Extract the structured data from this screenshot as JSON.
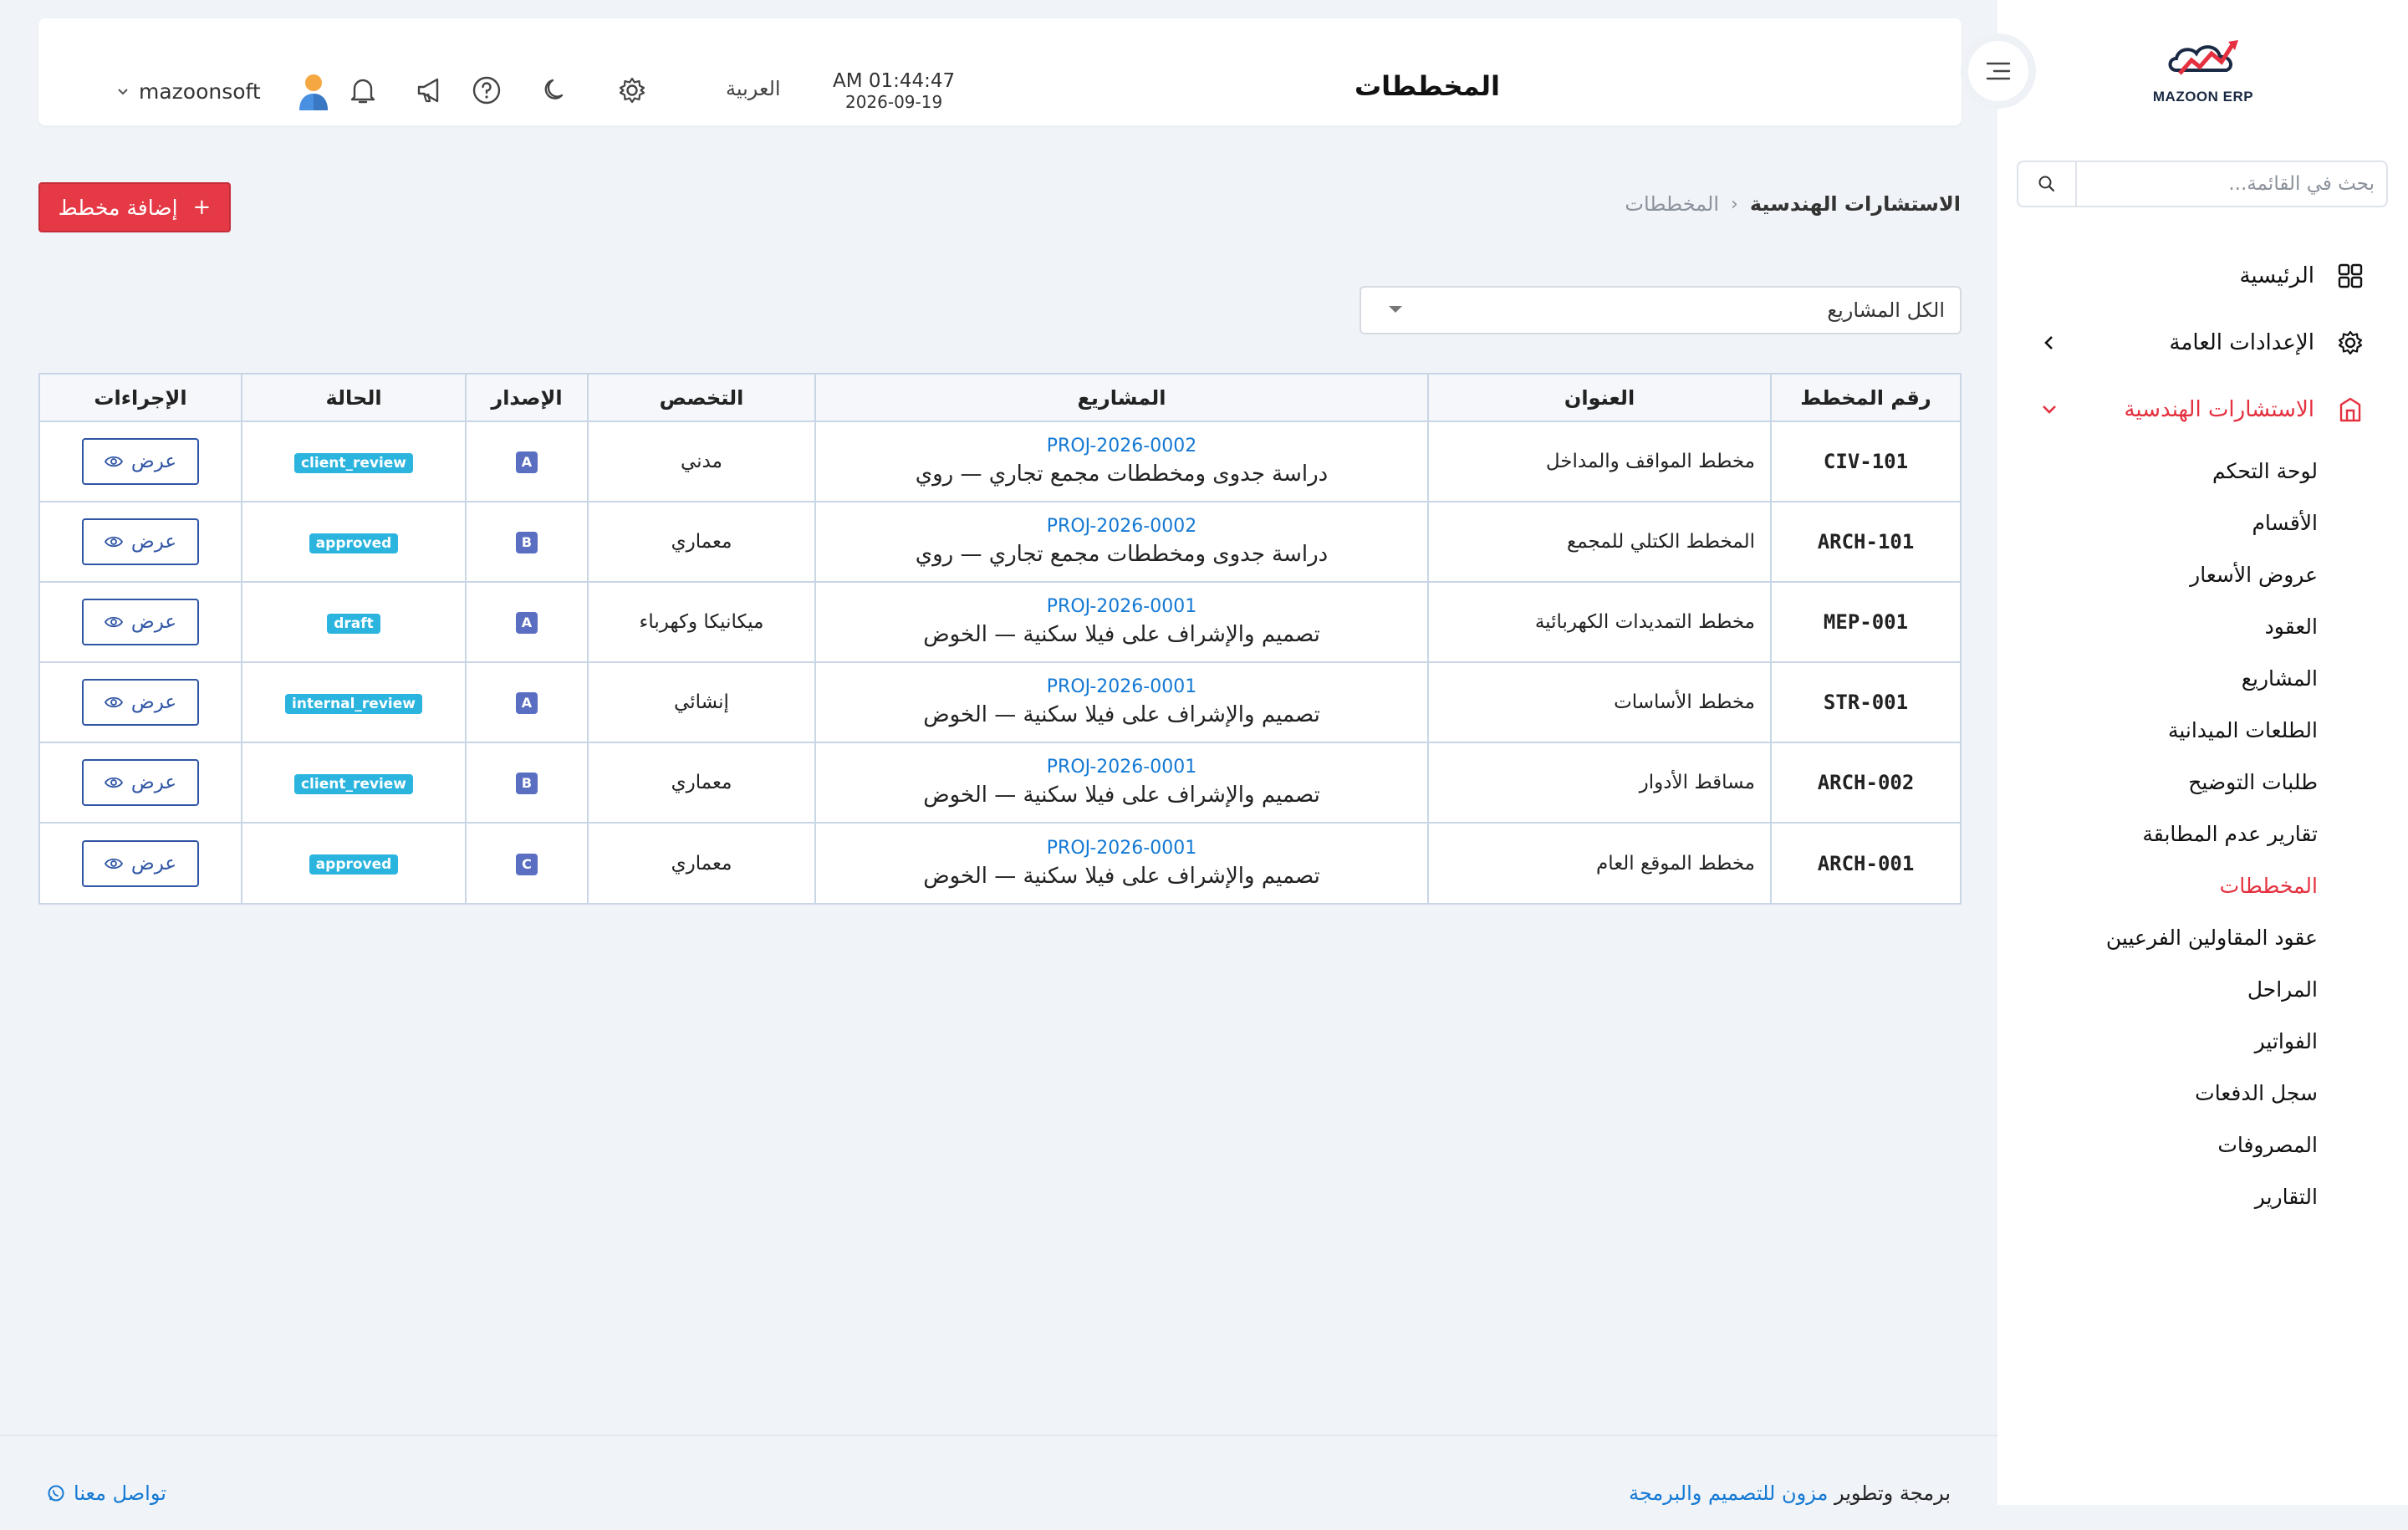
{
  "app": {
    "logo_text": "MAZOON ERP",
    "brand_color": "#e4303f",
    "link_color": "#1479d4"
  },
  "sidebar": {
    "search_placeholder": "بحث في القائمة...",
    "items": [
      {
        "label": "الرئيسية",
        "icon": "grid-icon"
      },
      {
        "label": "الإعدادات العامة",
        "icon": "gear-icon"
      },
      {
        "label": "الاستشارات الهندسية",
        "icon": "building-icon"
      }
    ],
    "sub_items": [
      "لوحة التحكم",
      "الأقسام",
      "عروض الأسعار",
      "العقود",
      "المشاريع",
      "الطلعات الميدانية",
      "طلبات التوضيح",
      "تقارير عدم المطابقة",
      "المخططات",
      "عقود المقاولين الفرعيين",
      "المراحل",
      "الفواتير",
      "سجل الدفعات",
      "المصروفات",
      "التقارير"
    ],
    "active_sub": "المخططات"
  },
  "header": {
    "title": "المخططات",
    "time": "AM 01:44:47",
    "date": "2026-09-19",
    "language": "العربية",
    "username": "mazoonsoft"
  },
  "breadcrumb": {
    "parent": "الاستشارات الهندسية",
    "separator": "‹",
    "current": "المخططات"
  },
  "toolbar": {
    "add_label": "إضافة مخطط",
    "add_icon": "+",
    "filter_value": "الكل المشاريع"
  },
  "table": {
    "headers": [
      "رقم المخطط",
      "العنوان",
      "المشاريع",
      "التخصص",
      "الإصدار",
      "الحالة",
      "الإجراءات"
    ],
    "view_label": "عرض",
    "rows": [
      {
        "code": "CIV-101",
        "title": "مخطط المواقف والمداخل",
        "project_code": "PROJ-2026-0002",
        "project_name": "دراسة جدوى ومخططات مجمع تجاري — روي",
        "discipline": "مدني",
        "version": "A",
        "status": "client_review"
      },
      {
        "code": "ARCH-101",
        "title": "المخطط الكتلي للمجمع",
        "project_code": "PROJ-2026-0002",
        "project_name": "دراسة جدوى ومخططات مجمع تجاري — روي",
        "discipline": "معماري",
        "version": "B",
        "status": "approved"
      },
      {
        "code": "MEP-001",
        "title": "مخطط التمديدات الكهربائية",
        "project_code": "PROJ-2026-0001",
        "project_name": "تصميم والإشراف على فيلا سكنية — الخوض",
        "discipline": "ميكانيكا وكهرباء",
        "version": "A",
        "status": "draft"
      },
      {
        "code": "STR-001",
        "title": "مخطط الأساسات",
        "project_code": "PROJ-2026-0001",
        "project_name": "تصميم والإشراف على فيلا سكنية — الخوض",
        "discipline": "إنشائي",
        "version": "A",
        "status": "internal_review"
      },
      {
        "code": "ARCH-002",
        "title": "مساقط الأدوار",
        "project_code": "PROJ-2026-0001",
        "project_name": "تصميم والإشراف على فيلا سكنية — الخوض",
        "discipline": "معماري",
        "version": "B",
        "status": "client_review"
      },
      {
        "code": "ARCH-001",
        "title": "مخطط الموقع العام",
        "project_code": "PROJ-2026-0001",
        "project_name": "تصميم والإشراف على فيلا سكنية — الخوض",
        "discipline": "معماري",
        "version": "C",
        "status": "approved"
      }
    ]
  },
  "footer": {
    "credit_prefix": "برمجة وتطوير",
    "credit_link": "مزون للتصميم والبرمجة",
    "contact": "تواصل معنا"
  }
}
